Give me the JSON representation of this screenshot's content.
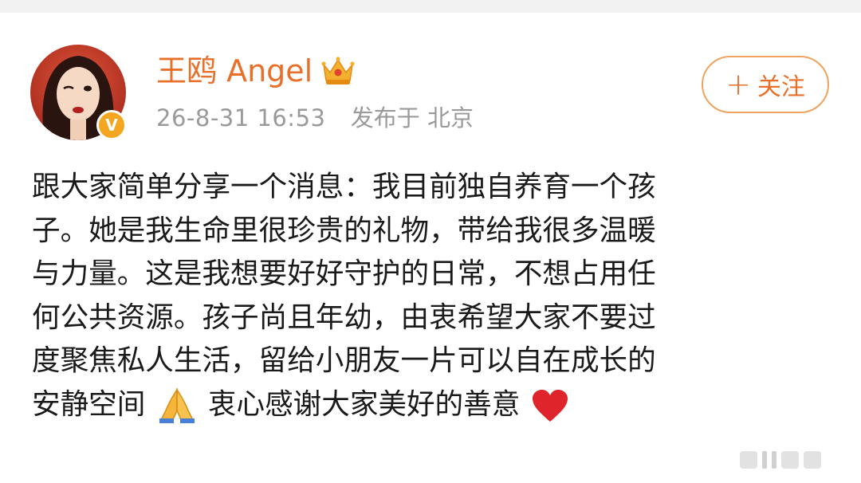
{
  "post": {
    "username": "王鸥 Angel",
    "timestamp": "26-8-31 16:53",
    "location_prefix": "发布于",
    "location": "北京",
    "follow_label": "关注",
    "follow_plus": "+",
    "verified_badge": "V",
    "badge_icon": "crown-icon",
    "lines": [
      "跟大家简单分享一个消息：我目前独自养育一个孩",
      "子。她是我生命里很珍贵的礼物，带给我很多温暖",
      "与力量。这是我想要好好守护的日常，不想占用任",
      "何公共资源。孩子尚且年幼，由衷希望大家不要过",
      "度聚焦私人生活，留给小朋友一片可以自在成长的"
    ],
    "last_line_a": "安静空间",
    "last_line_b": "衷心感谢大家美好的善意"
  },
  "colors": {
    "accent": "#e8702a",
    "meta": "#9a9a9a",
    "text": "#1a1a1a",
    "verified": "#f4a621",
    "heart": "#e0242b"
  }
}
